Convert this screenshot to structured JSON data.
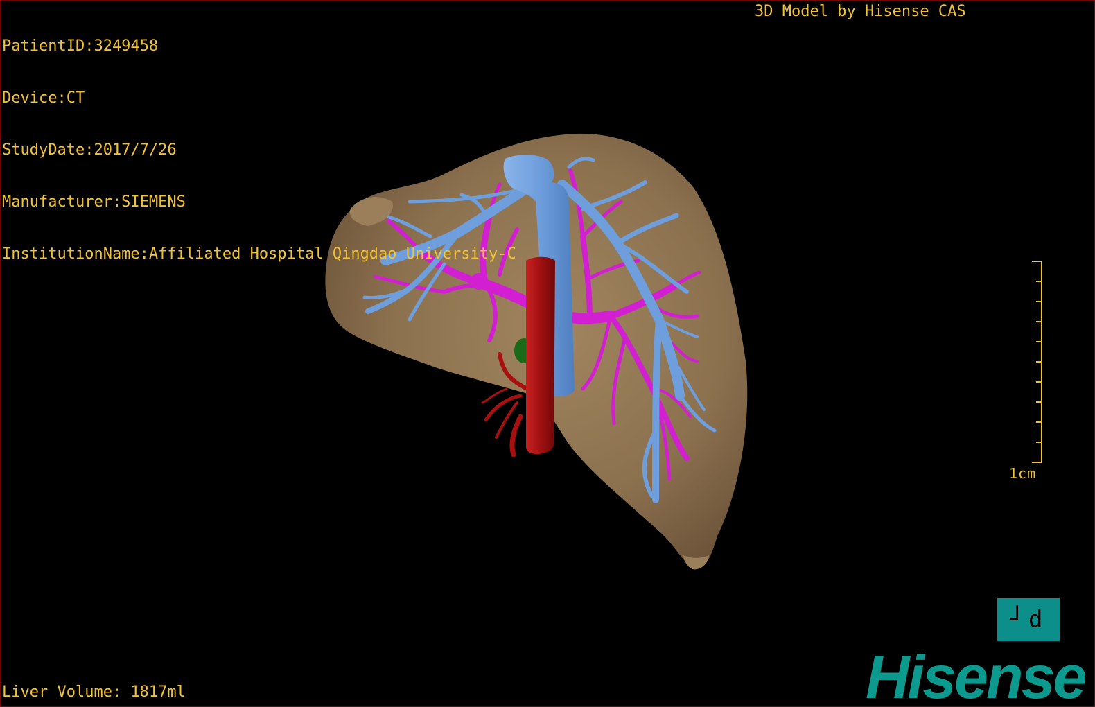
{
  "header": {
    "patient_id": "PatientID:3249458",
    "device": "Device:CT",
    "study_date": "StudyDate:2017/7/26",
    "manufacturer": "Manufacturer:SIEMENS",
    "institution": "InstitutionName:Affiliated Hospital Qingdao University-C"
  },
  "credit": "3D Model by Hisense CAS",
  "footer": {
    "liver_volume": "Liver Volume: 1817ml"
  },
  "scale": {
    "label": "1cm"
  },
  "orientation_button": {
    "label": "┘d"
  },
  "brand": {
    "logo_text": "Hisense"
  },
  "colors": {
    "overlay_text": "#f2c230",
    "liver": "#8b7355",
    "hepatic_vein": "#6f9edc",
    "portal_vein": "#d21fd2",
    "artery_ivc": "#b01010",
    "brand": "#0c9a8e",
    "border": "#7a0000"
  }
}
